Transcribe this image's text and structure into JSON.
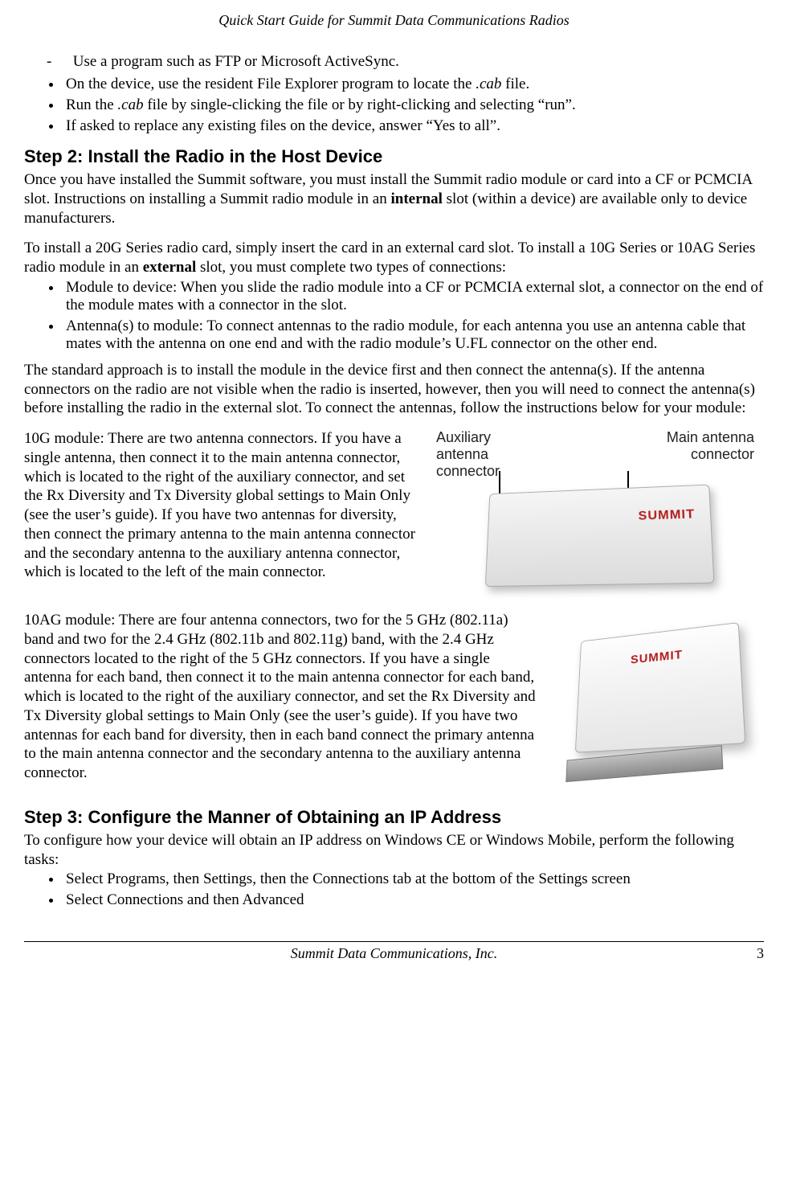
{
  "header": {
    "running_title": "Quick Start Guide for Summit Data Communications Radios"
  },
  "pre_step2": {
    "dash_item": "Use a program such as FTP or Microsoft ActiveSync.",
    "bullets": [
      {
        "pre": "On the device, use the resident File Explorer program to locate the ",
        "ital": ".cab",
        "post": " file."
      },
      {
        "pre": "Run the ",
        "ital": ".cab",
        "post": " file by single-clicking the file or by right-clicking and selecting “run”."
      },
      {
        "pre": "If asked to replace any existing files on the device, answer “Yes to all”.",
        "ital": "",
        "post": ""
      }
    ]
  },
  "step2": {
    "heading": "Step 2: Install the Radio in the Host Device",
    "p1_pre": "Once you have installed the Summit software, you must install the Summit radio module or card into a CF or PCMCIA slot.  Instructions on installing a Summit radio module in an ",
    "p1_bold": "internal",
    "p1_post": " slot (within a device) are available only to device manufacturers.",
    "p2_pre": "To install a 20G Series radio card, simply insert the card in an external card slot.  To install a 10G Series or 10AG Series radio module in an ",
    "p2_bold": "external",
    "p2_post": " slot, you must complete two types of connections:",
    "bullets": [
      "Module to device: When you slide the radio module into a CF or PCMCIA external slot, a connector on the end of the module mates with a connector in the slot.",
      "Antenna(s) to module: To connect antennas to the radio module, for each antenna you use an antenna cable that mates with the antenna on one end and with the radio module’s U.FL connector on the other end."
    ],
    "p3": "The standard approach is to install the module in the device first and then connect the antenna(s).  If the antenna connectors on the radio are not visible when the radio is inserted, however, then you will need to connect the antenna(s) before installing the radio in the external slot.  To connect the antennas, follow the instructions below for your module:",
    "mod10g": "10G module: There are two antenna connectors.  If you have a single antenna, then connect it to the main antenna connector, which is located to the right of the auxiliary connector, and set the Rx Diversity and Tx Diversity global settings to Main Only (see the user’s guide). If you have two antennas for diversity, then connect the primary antenna to the main antenna connector and the secondary antenna to the auxiliary antenna connector, which is located to the left of the main connector.",
    "fig10g_labels": {
      "aux_l1": "Auxiliary",
      "aux_l2": "antenna",
      "aux_l3": "connector",
      "main_l1": "Main antenna",
      "main_l2": "connector"
    },
    "mod10ag": "10AG module: There are four antenna connectors, two for the 5 GHz (802.11a) band and two for the 2.4 GHz (802.11b and 802.11g) band, with the 2.4 GHz connectors located to the right of the 5 GHz connectors. If you have a single antenna for each band, then connect it to the main antenna connector for each band, which is located to the right of the auxiliary connector, and set the Rx Diversity and Tx Diversity global settings to Main Only (see the user’s guide). If you have two antennas for each band for diversity, then in each band connect the primary antenna to the main antenna connector and the secondary antenna to the auxiliary antenna connector."
  },
  "step3": {
    "heading": "Step 3: Configure the Manner of Obtaining an IP Address",
    "p1": "To configure how your device will obtain an IP address on Windows CE or Windows Mobile, perform the following tasks:",
    "bullets": [
      "Select Programs, then Settings, then the Connections tab at the bottom of the Settings screen",
      "Select Connections and then Advanced"
    ]
  },
  "footer": {
    "company": "Summit Data Communications, Inc.",
    "page_number": "3"
  }
}
